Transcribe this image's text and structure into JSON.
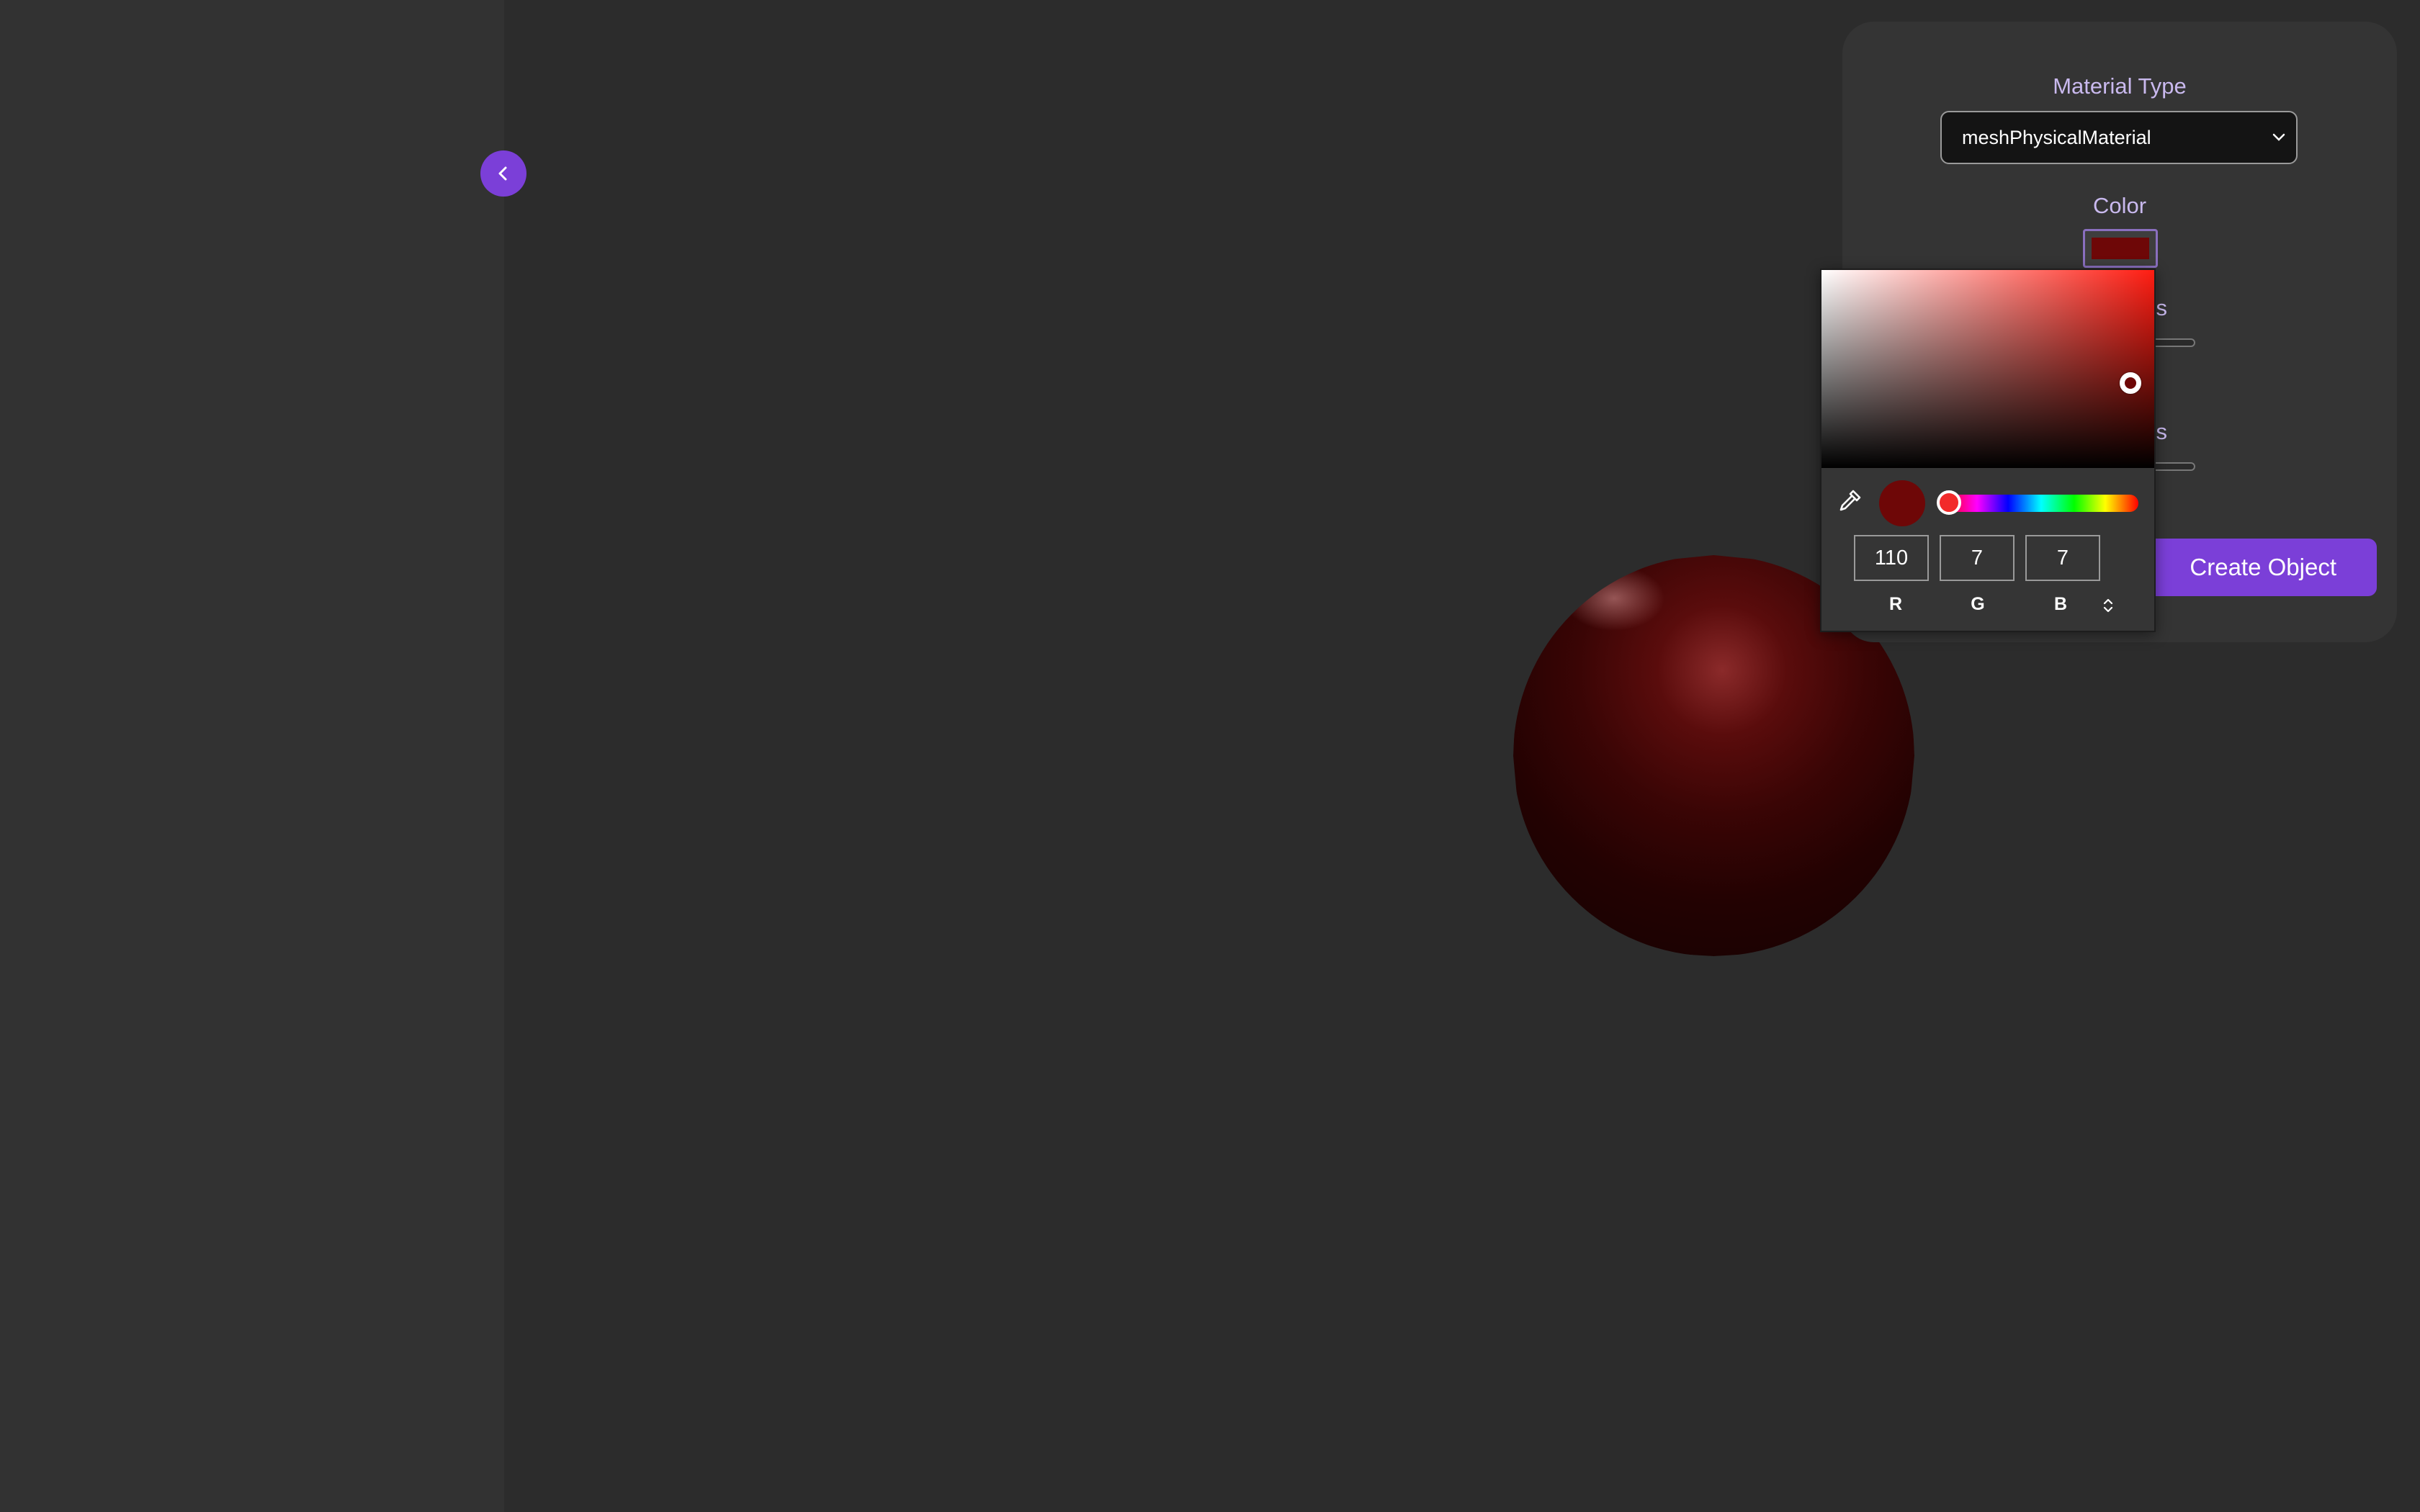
{
  "panel": {
    "material_type_label": "Material Type",
    "material_type_value": "meshPhysicalMaterial",
    "color_label": "Color",
    "color_value": "#6e0707",
    "roughness_label_partial": "ss",
    "metalness_label_partial": "ss",
    "create_button_label": "Create Object"
  },
  "color_picker": {
    "hue_color": "#ff1d12",
    "channels": [
      {
        "label": "R",
        "value": "110"
      },
      {
        "label": "G",
        "value": "7"
      },
      {
        "label": "B",
        "value": "7"
      }
    ],
    "icons": {
      "eyedropper": "eyedropper-icon",
      "mode_toggle": "up-down-arrows-icon"
    }
  },
  "sidebar": {
    "toggle_icon": "chevron-left-icon",
    "accent_color": "#7b3fd8"
  },
  "scene": {
    "object": "sphere",
    "object_color": "#6e0707"
  }
}
